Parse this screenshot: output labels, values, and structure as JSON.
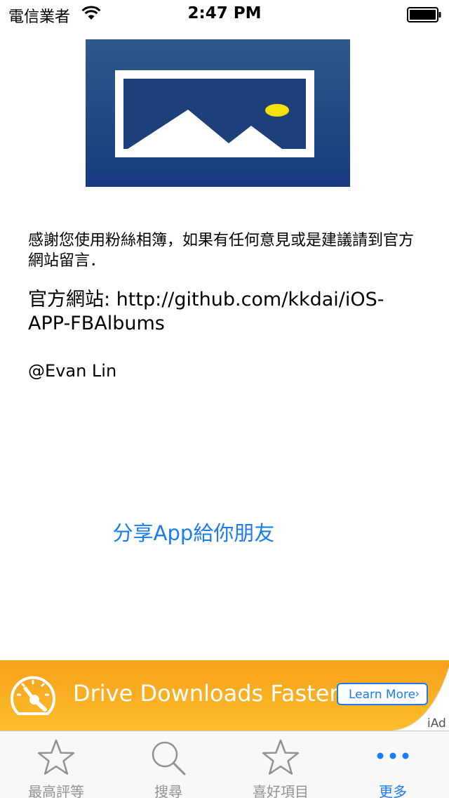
{
  "status_bar": {
    "carrier": "電信業者",
    "time": "2:47 PM"
  },
  "about": {
    "thanks_text": "感謝您使用粉絲相簿，如果有任何意見或是建議請到官方網站留言．",
    "website_text": "官方網站: http://github.com/kkdai/iOS-APP-FBAlbums",
    "author": "@Evan Lin"
  },
  "share_button": "分享App給你朋友",
  "ad": {
    "headline": "Drive Downloads Faster",
    "button": "Learn More",
    "label": "iAd",
    "colors": {
      "orange_start": "#f9a51b",
      "orange_end": "#fbc02d",
      "accent": "#1a7cf4"
    }
  },
  "tab_bar": {
    "tabs": [
      {
        "label": "最高評等",
        "icon": "star-icon"
      },
      {
        "label": "搜尋",
        "icon": "search-icon"
      },
      {
        "label": "喜好項目",
        "icon": "star-icon"
      },
      {
        "label": "更多",
        "icon": "more-icon",
        "active": true
      }
    ]
  }
}
